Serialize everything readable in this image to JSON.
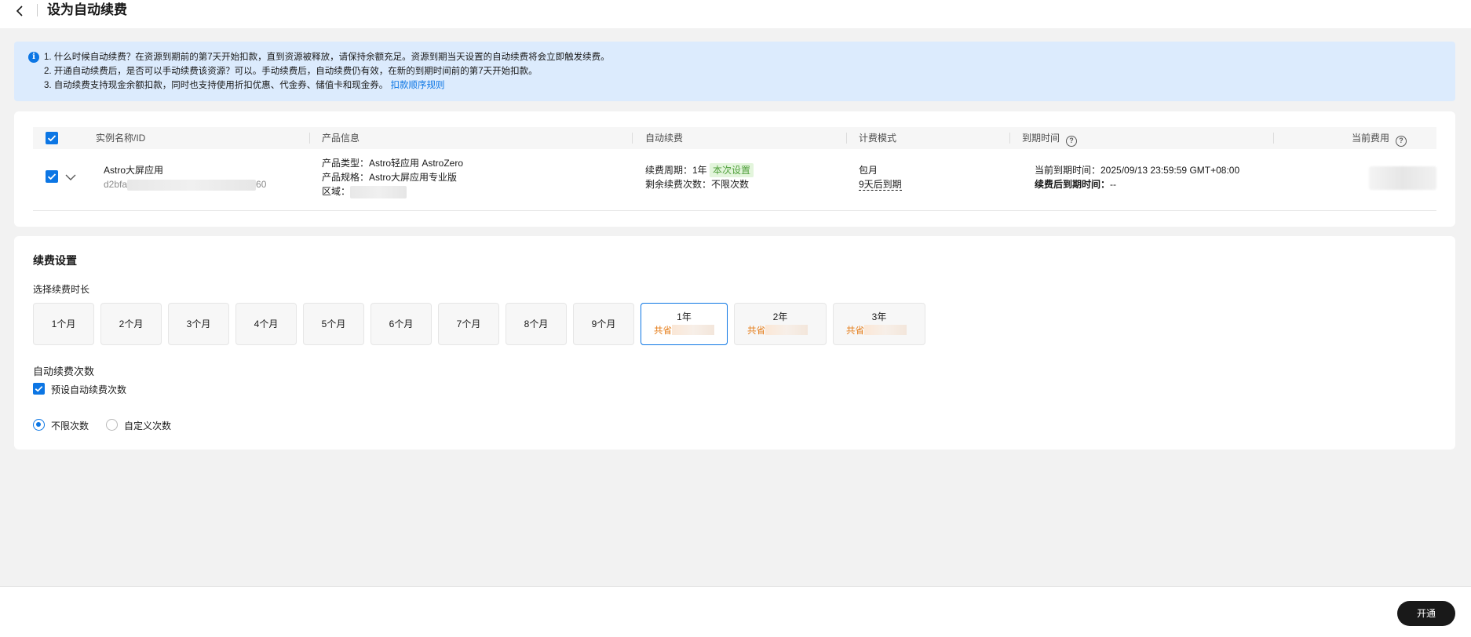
{
  "header": {
    "title": "设为自动续费",
    "back_icon": "chevron-left-icon"
  },
  "notice": {
    "icon": "info-icon",
    "line1": "1. 什么时候自动续费？在资源到期前的第7天开始扣款，直到资源被释放，请保持余额充足。资源到期当天设置的自动续费将会立即触发续费。",
    "line2": "2. 开通自动续费后，是否可以手动续费该资源？可以。手动续费后，自动续费仍有效，在新的到期时间前的第7天开始扣款。",
    "line3_text": "3. 自动续费支持现金余额扣款，同时也支持使用折扣优惠、代金券、储值卡和现金券。",
    "line3_link": "扣款顺序规则"
  },
  "table": {
    "headers": {
      "name": "实例名称/ID",
      "product": "产品信息",
      "auto_renew": "自动续费",
      "billing": "计费模式",
      "expire": "到期时间",
      "fee": "当前费用"
    },
    "row": {
      "name": "Astro大屏应用",
      "id_prefix": "d2bfa",
      "id_suffix": "60",
      "product_type": "产品类型：Astro轻应用 AstroZero",
      "product_spec": "产品规格：Astro大屏应用专业版",
      "region_label": "区域：",
      "renew_cycle_label": "续费周期：1年",
      "renew_cycle_tag": "本次设置",
      "remaining_times": "剩余续费次数：不限次数",
      "billing_mode": "包月",
      "billing_expire": "9天后到期",
      "current_expire": "当前到期时间：2025/09/13 23:59:59 GMT+08:00",
      "after_renew_label": "续费后到期时间：",
      "after_renew_value": "--"
    }
  },
  "settings": {
    "title": "续费设置",
    "duration_label": "选择续费时长",
    "durations": [
      "1个月",
      "2个月",
      "3个月",
      "4个月",
      "5个月",
      "6个月",
      "7个月",
      "8个月",
      "9个月",
      "1年",
      "2年",
      "3年"
    ],
    "selected_duration": "1年",
    "save_prefix": "共省",
    "times_label": "自动续费次数",
    "preset_checkbox": "预设自动续费次数",
    "radio_unlimited": "不限次数",
    "radio_custom": "自定义次数"
  },
  "footer": {
    "submit": "开通"
  },
  "colors": {
    "accent": "#0c76e4",
    "notice_bg": "#dcebfd",
    "save_orange": "#e57b16",
    "tag_green": "#50a03c"
  }
}
